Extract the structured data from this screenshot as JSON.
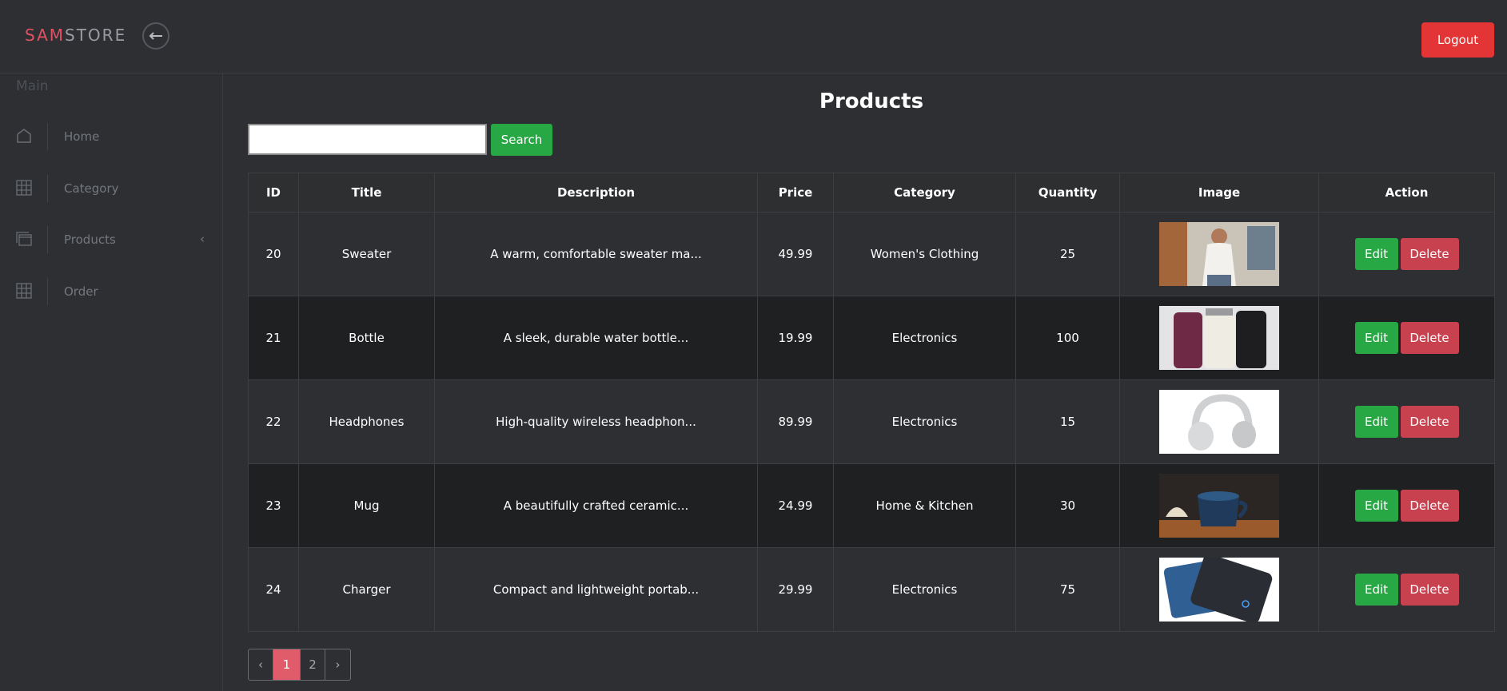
{
  "brand": {
    "part1": "SAM",
    "part2": "STORE"
  },
  "header": {
    "logout_label": "Logout"
  },
  "sidebar": {
    "section_label": "Main",
    "items": [
      {
        "label": "Home",
        "icon": "home-icon"
      },
      {
        "label": "Category",
        "icon": "grid-icon"
      },
      {
        "label": "Products",
        "icon": "stack-icon",
        "chevron": "‹"
      },
      {
        "label": "Order",
        "icon": "grid-icon"
      }
    ]
  },
  "main": {
    "title": "Products",
    "search": {
      "value": "",
      "placeholder": "",
      "button_label": "Search"
    },
    "table": {
      "columns": [
        "ID",
        "Title",
        "Description",
        "Price",
        "Category",
        "Quantity",
        "Image",
        "Action"
      ],
      "rows": [
        {
          "id": "20",
          "title": "Sweater",
          "description": "A warm, comfortable sweater ma...",
          "price": "49.99",
          "category": "Women's Clothing",
          "quantity": "25",
          "image": "sweater-photo"
        },
        {
          "id": "21",
          "title": "Bottle",
          "description": "A sleek, durable water bottle...",
          "price": "19.99",
          "category": "Electronics",
          "quantity": "100",
          "image": "bottles-photo"
        },
        {
          "id": "22",
          "title": "Headphones",
          "description": "High-quality wireless headphon...",
          "price": "89.99",
          "category": "Electronics",
          "quantity": "15",
          "image": "headphones-photo"
        },
        {
          "id": "23",
          "title": "Mug",
          "description": "A beautifully crafted ceramic...",
          "price": "24.99",
          "category": "Home & Kitchen",
          "quantity": "30",
          "image": "mug-photo"
        },
        {
          "id": "24",
          "title": "Charger",
          "description": "Compact and lightweight portab...",
          "price": "29.99",
          "category": "Electronics",
          "quantity": "75",
          "image": "powerbank-photo"
        }
      ],
      "edit_label": "Edit",
      "delete_label": "Delete"
    },
    "pagination": {
      "prev": "‹",
      "pages": [
        "1",
        "2"
      ],
      "active": "1",
      "next": "›"
    }
  },
  "colors": {
    "accent": "#e05263",
    "success": "#28a745",
    "danger": "#c8414f",
    "logout": "#e33535"
  }
}
